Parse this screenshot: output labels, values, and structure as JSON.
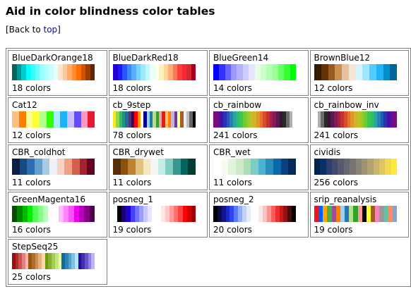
{
  "page": {
    "title": "Aid in color blindness color tables",
    "back_prefix": "[Back to ",
    "back_link": "top",
    "back_suffix": "]"
  },
  "tables": [
    {
      "name": "BlueDarkOrange18",
      "count": "18 colors",
      "colors": [
        "#006666",
        "#009999",
        "#00cccc",
        "#00ffff",
        "#33ffff",
        "#66ffff",
        "#99ffff",
        "#b2ffff",
        "#cbffff",
        "#e5ffff",
        "#ffe5cb",
        "#ffca99",
        "#ffad65",
        "#ff8e33",
        "#ff6e00",
        "#cc5500",
        "#993d00",
        "#662700"
      ]
    },
    {
      "name": "BlueDarkRed18",
      "count": "18 colors",
      "colors": [
        "#2400d8",
        "#181cf7",
        "#2857ff",
        "#3d87ff",
        "#56b0ff",
        "#75d3ff",
        "#99eaff",
        "#bcf9ff",
        "#eaffff",
        "#ffffea",
        "#fff1bc",
        "#ffd699",
        "#ffac75",
        "#ff7856",
        "#ff3d3d",
        "#f72735",
        "#d82632",
        "#a50021"
      ]
    },
    {
      "name": "BlueGreen14",
      "count": "14 colors",
      "colors": [
        "#0000ff",
        "#3333ff",
        "#6666ff",
        "#9999ff",
        "#b2b2ff",
        "#ccccff",
        "#e5e5ff",
        "#e5ffe5",
        "#ccffcc",
        "#b2ffb2",
        "#99ff99",
        "#66ff66",
        "#33ff33",
        "#00ff00"
      ]
    },
    {
      "name": "BrownBlue12",
      "count": "12 colors",
      "colors": [
        "#331a00",
        "#663000",
        "#995c1f",
        "#cc8f52",
        "#e6c29e",
        "#f5e6d6",
        "#d6f5ff",
        "#9ee6ff",
        "#52ccff",
        "#1fb2f5",
        "#008fcc",
        "#006699"
      ]
    },
    {
      "name": "Cat12",
      "count": "12 colors",
      "colors": [
        "#ffbf7f",
        "#ff7f00",
        "#ffff99",
        "#ffff32",
        "#b2ff8c",
        "#32ff00",
        "#a5edff",
        "#19b2ff",
        "#ccbfff",
        "#654cff",
        "#ff99bf",
        "#e51932"
      ]
    },
    {
      "name": "cb_9step",
      "count": "78 colors",
      "colors": [
        "#fde725",
        "#90d743",
        "#35b779",
        "#21918c",
        "#31688e",
        "#443983",
        "#440154",
        "#ff0000",
        "#ff9900",
        "#ffffff",
        "#0000aa",
        "#a6cee3",
        "#1f78b4",
        "#b2df8a",
        "#33a02c",
        "#fb9a99",
        "#e31a1c",
        "#fdbf6f",
        "#ff7f00",
        "#cab2d6",
        "#6a3d9a",
        "#ffff99",
        "#b15928",
        "#f0f0f0",
        "#bdbdbd",
        "#636363",
        "#000000"
      ]
    },
    {
      "name": "cb_rainbow",
      "count": "241 colors",
      "colors": [
        "#7f0a7a",
        "#6a0e94",
        "#4412a6",
        "#2a33b0",
        "#2458b8",
        "#247fb3",
        "#2aa59a",
        "#2fbd6e",
        "#3ec849",
        "#6ccc32",
        "#98cb2a",
        "#bcc327",
        "#d4b129",
        "#df952a",
        "#e2742a",
        "#d94e2a",
        "#c4302e",
        "#a52144",
        "#801b5c",
        "#58194c",
        "#371535",
        "#2a2a2a",
        "#6b6b6b",
        "#b0b0b0",
        "#ffffff"
      ]
    },
    {
      "name": "cb_rainbow_inv",
      "count": "241 colors",
      "colors": [
        "#ffffff",
        "#b0b0b0",
        "#6b6b6b",
        "#2a2a2a",
        "#371535",
        "#58194c",
        "#801b5c",
        "#a52144",
        "#c4302e",
        "#d94e2a",
        "#e2742a",
        "#df952a",
        "#d4b129",
        "#bcc327",
        "#98cb2a",
        "#6ccc32",
        "#3ec849",
        "#2fbd6e",
        "#2aa59a",
        "#247fb3",
        "#2458b8",
        "#2a33b0",
        "#4412a6",
        "#6a0e94",
        "#7f0a7a"
      ]
    },
    {
      "name": "CBR_coldhot",
      "count": "11 colors",
      "colors": [
        "#0d1e46",
        "#184a7e",
        "#2d6eb0",
        "#64a0cd",
        "#a8cbe4",
        "#eef1f3",
        "#f8d2c3",
        "#f0a085",
        "#d3604a",
        "#a4222f",
        "#67001f"
      ]
    },
    {
      "name": "CBR_drywet",
      "count": "11 colors",
      "colors": [
        "#562e06",
        "#8c510a",
        "#bf812d",
        "#dfc27d",
        "#f6e8c3",
        "#f5f5f5",
        "#c7eae5",
        "#80cdc1",
        "#35978f",
        "#01665e",
        "#003c30"
      ]
    },
    {
      "name": "CBR_wet",
      "count": "11 colors",
      "colors": [
        "#ffffff",
        "#f7fcf0",
        "#e0f3db",
        "#ccebc5",
        "#a8ddb5",
        "#7bccc4",
        "#4eb3d3",
        "#2b8cbe",
        "#0868ac",
        "#084081",
        "#062b57"
      ]
    },
    {
      "name": "cividis",
      "count": "256 colors",
      "colors": [
        "#00224e",
        "#08306b",
        "#2d3e6e",
        "#424b6d",
        "#555a6f",
        "#676770",
        "#797575",
        "#8b8478",
        "#9f9376",
        "#b3a371",
        "#c8b46a",
        "#ddc65e",
        "#f2d84f",
        "#fee838"
      ]
    },
    {
      "name": "GreenMagenta16",
      "count": "16 colors",
      "colors": [
        "#005000",
        "#008600",
        "#00bb00",
        "#00f000",
        "#50ff50",
        "#86ff86",
        "#bbffbb",
        "#ffffff",
        "#ffffff",
        "#ffbbff",
        "#ff86ff",
        "#ff50ff",
        "#f000f0",
        "#bb00bb",
        "#860086",
        "#500050"
      ]
    },
    {
      "name": "posneg_1",
      "count": "19 colors",
      "colors": [
        "#ffffff",
        "#000000",
        "#1b006e",
        "#1f00c7",
        "#4141ff",
        "#7272ff",
        "#9d9dff",
        "#c8c8ff",
        "#e6e6ff",
        "#ffffff",
        "#ffffff",
        "#ffe6e6",
        "#ffc8c8",
        "#ff9d9d",
        "#ff7272",
        "#ff4141",
        "#ff0000",
        "#d00000",
        "#9a0000"
      ]
    },
    {
      "name": "posneg_2",
      "count": "20 colors",
      "colors": [
        "#000000",
        "#0c0b48",
        "#14158c",
        "#1b27c7",
        "#2d48f0",
        "#5e7cf7",
        "#93aef6",
        "#c3d5f6",
        "#e6ecfa",
        "#ffffff",
        "#ffffff",
        "#fae6e6",
        "#f6c3c3",
        "#f69393",
        "#f75e5e",
        "#f02d2d",
        "#c71b1b",
        "#8c1414",
        "#480c0b",
        "#000000"
      ]
    },
    {
      "name": "srip_reanalysis",
      "count": "19 colors",
      "colors": [
        "#e4191c",
        "#0061ff",
        "#ffa500",
        "#4daf4a",
        "#984ea3",
        "#ff7f00",
        "#a6cee3",
        "#1f78b4",
        "#b2df8a",
        "#33a02c",
        "#fb9a99",
        "#000000",
        "#ffff33",
        "#a65628",
        "#f781bf",
        "#999999",
        "#66c2a5",
        "#fc8d62",
        "#8da0cb"
      ]
    },
    {
      "name": "StepSeq25",
      "count": "25 colors",
      "colors": [
        "#990f0f",
        "#b22c2c",
        "#cc5151",
        "#e57e7e",
        "#ffb2b2",
        "#99540f",
        "#b26f2c",
        "#cc8e51",
        "#e5b17e",
        "#ffd8b2",
        "#6b990f",
        "#85b22c",
        "#a3cc51",
        "#c3e57e",
        "#e5ffb2",
        "#0f6b99",
        "#2c85b2",
        "#51a3cc",
        "#7ec3e5",
        "#b2e5ff",
        "#260f99",
        "#422cb2",
        "#6551cc",
        "#8f7ee5",
        "#bfb2ff"
      ]
    }
  ]
}
